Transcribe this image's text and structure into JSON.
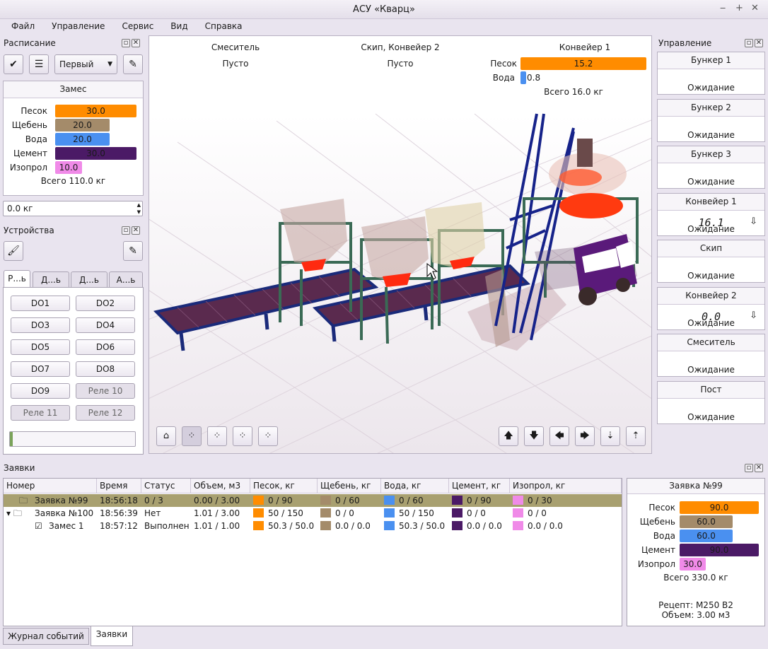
{
  "window": {
    "title": "АСУ «Кварц»"
  },
  "menu": [
    "Файл",
    "Управление",
    "Сервис",
    "Вид",
    "Справка"
  ],
  "schedule": {
    "title": "Расписание",
    "mode": "Первый",
    "batch_title": "Замес",
    "items": [
      {
        "label": "Песок",
        "value": "30.0",
        "color": "#ff8c00",
        "frac": 1.0
      },
      {
        "label": "Щебень",
        "value": "20.0",
        "color": "#a48b6a",
        "frac": 0.67
      },
      {
        "label": "Вода",
        "value": "20.0",
        "color": "#4a90f0",
        "frac": 0.67
      },
      {
        "label": "Цемент",
        "value": "30.0",
        "color": "#4b1a66",
        "frac": 1.0
      },
      {
        "label": "Изопрол",
        "value": "10.0",
        "color": "#f08ae8",
        "frac": 0.33
      }
    ],
    "total": "Всего 110.0 кг",
    "weight_input": "0.0 кг"
  },
  "devices": {
    "title": "Устройства",
    "tabs": [
      "Р...ь",
      "Д...ь",
      "Д...ь",
      "А...ь"
    ],
    "buttons": [
      "DO1",
      "DO2",
      "DO3",
      "DO4",
      "DO5",
      "DO6",
      "DO7",
      "DO8",
      "DO9",
      "Реле 10",
      "Реле 11",
      "Реле 12"
    ]
  },
  "scene": {
    "mixer": {
      "title": "Смеситель",
      "status": "Пусто"
    },
    "skip": {
      "title": "Скип, Конвейер 2",
      "status": "Пусто"
    },
    "conv1": {
      "title": "Конвейер 1",
      "sand_label": "Песок",
      "sand_value": "15.2",
      "water_label": "Вода",
      "water_value": "0.8",
      "total": "Всего 16.0 кг"
    }
  },
  "control": {
    "title": "Управление",
    "units": [
      {
        "name": "Бункер 1",
        "status": "Ожидание",
        "value": ""
      },
      {
        "name": "Бункер 2",
        "status": "Ожидание",
        "value": ""
      },
      {
        "name": "Бункер 3",
        "status": "Ожидание",
        "value": ""
      },
      {
        "name": "Конвейер 1",
        "status": "Ожидание",
        "value": "16.1"
      },
      {
        "name": "Скип",
        "status": "Ожидание",
        "value": ""
      },
      {
        "name": "Конвейер 2",
        "status": "Ожидание",
        "value": "0.0"
      },
      {
        "name": "Смеситель",
        "status": "Ожидание",
        "value": ""
      },
      {
        "name": "Пост",
        "status": "Ожидание",
        "value": ""
      }
    ]
  },
  "orders": {
    "title": "Заявки",
    "columns": [
      "Номер",
      "Время",
      "Статус",
      "Объем, м3",
      "Песок, кг",
      "Щебень, кг",
      "Вода, кг",
      "Цемент, кг",
      "Изопрол, кг"
    ],
    "rows": [
      {
        "num": "Заявка №99",
        "time": "18:56:18",
        "status": "0 / 3",
        "volume": "0.00 / 3.00",
        "sand": "0 / 90",
        "gravel": "0 / 60",
        "water": "0 / 60",
        "cement": "0 / 90",
        "iso": "0 / 30"
      },
      {
        "num": "Заявка №100",
        "time": "18:56:39",
        "status": "Нет",
        "volume": "1.01 / 3.00",
        "sand": "50 / 150",
        "gravel": "0 / 0",
        "water": "50 / 150",
        "cement": "0 / 0",
        "iso": "0 / 0"
      },
      {
        "num": "Замес 1",
        "time": "18:57:12",
        "status": "Выполнен",
        "volume": "1.01 / 1.00",
        "sand": "50.3 / 50.0",
        "gravel": "0.0 / 0.0",
        "water": "50.3 / 50.0",
        "cement": "0.0 / 0.0",
        "iso": "0.0 / 0.0"
      }
    ],
    "detail": {
      "title": "Заявка №99",
      "items": [
        {
          "label": "Песок",
          "value": "90.0"
        },
        {
          "label": "Щебень",
          "value": "60.0"
        },
        {
          "label": "Вода",
          "value": "60.0"
        },
        {
          "label": "Цемент",
          "value": "90.0"
        },
        {
          "label": "Изопрол",
          "value": "30.0"
        }
      ],
      "total": "Всего 330.0 кг",
      "recipe": "Рецепт: М250 В2",
      "volume": "Объем: 3.00 м3"
    }
  },
  "bottom_tabs": [
    "Журнал событий",
    "Заявки"
  ],
  "colors": {
    "sand": "#ff8c00",
    "gravel": "#a48b6a",
    "water": "#4a90f0",
    "cement": "#4b1a66",
    "iso": "#f08ae8",
    "selected_row": "#a8a070"
  }
}
